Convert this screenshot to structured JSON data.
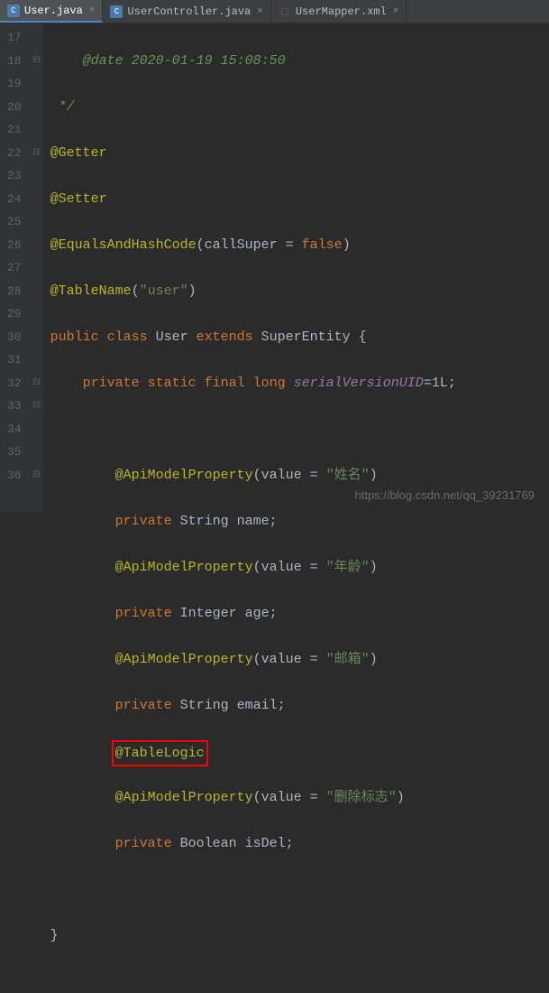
{
  "tabs": [
    {
      "label": "User.java",
      "icon": "C",
      "iconBg": "#4a7cb0",
      "active": true,
      "type": "java"
    },
    {
      "label": "UserController.java",
      "icon": "C",
      "iconBg": "#4a7cb0",
      "active": false,
      "type": "java"
    },
    {
      "label": "UserMapper.xml",
      "icon": "⬚",
      "iconBg": "#c27e3a",
      "active": false,
      "type": "xml"
    }
  ],
  "lineNumbers": [
    "17",
    "18",
    "19",
    "20",
    "21",
    "22",
    "23",
    "24",
    "25",
    "26",
    "27",
    "28",
    "29",
    "30",
    "31",
    "32",
    "33",
    "34",
    "35",
    "36"
  ],
  "foldMarks": {
    "0": "",
    "1": "⊟",
    "5": "⊟",
    "15": "⊟",
    "16": "⊟",
    "19": "⊟"
  },
  "code": {
    "l17a": "@date",
    "l17b": " 2020-01-19 15:08:50",
    "l18": " */",
    "l19": "@Getter",
    "l20": "@Setter",
    "l21a": "@EqualsAndHashCode",
    "l21b": "(callSuper = ",
    "l21c": "false",
    "l21d": ")",
    "l22a": "@TableName",
    "l22b": "(",
    "l22c": "\"user\"",
    "l22d": ")",
    "l23a": "public class ",
    "l23b": "User ",
    "l23c": "extends ",
    "l23d": "SuperEntity {",
    "l24a": "private static final long ",
    "l24b": "serialVersionUID",
    "l24c": "=1L;",
    "l26a": "@ApiModelProperty",
    "l26b": "(value = ",
    "l26c": "\"姓名\"",
    "l26d": ")",
    "l27a": "private ",
    "l27b": "String name;",
    "l28a": "@ApiModelProperty",
    "l28b": "(value = ",
    "l28c": "\"年龄\"",
    "l28d": ")",
    "l29a": "private ",
    "l29b": "Integer age;",
    "l30a": "@ApiModelProperty",
    "l30b": "(value = ",
    "l30c": "\"邮箱\"",
    "l30d": ")",
    "l31a": "private ",
    "l31b": "String email;",
    "l32": "@TableLogic",
    "l33a": "@ApiModelProperty",
    "l33b": "(value = ",
    "l33c": "\"删除标志\"",
    "l33d": ")",
    "l34a": "private ",
    "l34b": "Boolean isDel;",
    "l36": "}"
  },
  "watermark": "https://blog.csdn.net/qq_39231769"
}
